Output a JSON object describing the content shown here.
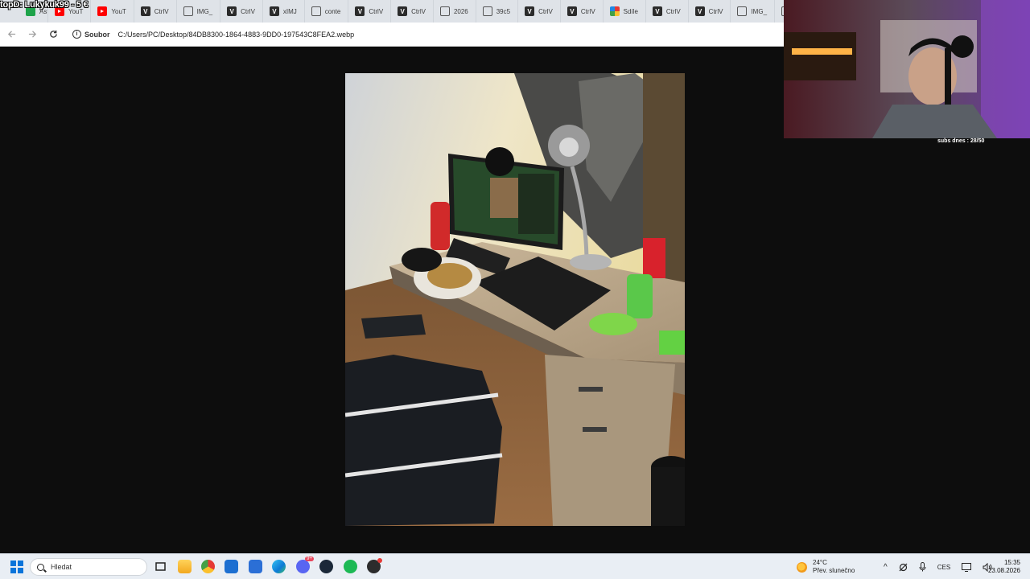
{
  "stream_overlay": {
    "top_donor": "topD: Lukykuk99 - 5 €",
    "subs_counter": "subs dnes : 28/50"
  },
  "browser": {
    "tabs": [
      {
        "label": "Astat",
        "icon": "green-app-icon"
      },
      {
        "label": "YouT",
        "icon": "youtube-icon"
      },
      {
        "label": "YouT",
        "icon": "youtube-icon"
      },
      {
        "label": "CtrlV",
        "icon": "ctrlv-icon"
      },
      {
        "label": "IMG_",
        "icon": "globe-icon"
      },
      {
        "label": "CtrlV",
        "icon": "ctrlv-icon"
      },
      {
        "label": "xIMJ",
        "icon": "ctrlv-icon"
      },
      {
        "label": "conte",
        "icon": "globe-icon"
      },
      {
        "label": "CtrlV",
        "icon": "ctrlv-icon"
      },
      {
        "label": "CtrlV",
        "icon": "ctrlv-icon"
      },
      {
        "label": "2026",
        "icon": "globe-icon"
      },
      {
        "label": "39c5",
        "icon": "globe-icon"
      },
      {
        "label": "CtrlV",
        "icon": "ctrlv-icon"
      },
      {
        "label": "CtrlV",
        "icon": "ctrlv-icon"
      },
      {
        "label": "Sdíle",
        "icon": "share-icon"
      },
      {
        "label": "CtrlV",
        "icon": "ctrlv-icon"
      },
      {
        "label": "CtrlV",
        "icon": "ctrlv-icon"
      },
      {
        "label": "IMG_",
        "icon": "globe-icon"
      },
      {
        "label": "IMG_",
        "icon": "globe-icon"
      }
    ],
    "address": {
      "chip": "Soubor",
      "url": "C:/Users/PC/Desktop/84DB8300-1864-4883-9DD0-197543C8FEA2.webp"
    }
  },
  "taskbar": {
    "search_placeholder": "Hledat",
    "pinned": [
      "task-view-icon",
      "file-explorer-icon",
      "chrome-icon",
      "store-icon",
      "mail-icon",
      "edge-icon",
      "discord-icon",
      "steam-icon",
      "spotify-icon",
      "obs-icon"
    ],
    "discord_badge": "9+",
    "weather": {
      "temp": "24°C",
      "desc": "Přev. slunečno"
    },
    "language": "CES",
    "time": "15:35",
    "date": "23.08.2026"
  }
}
